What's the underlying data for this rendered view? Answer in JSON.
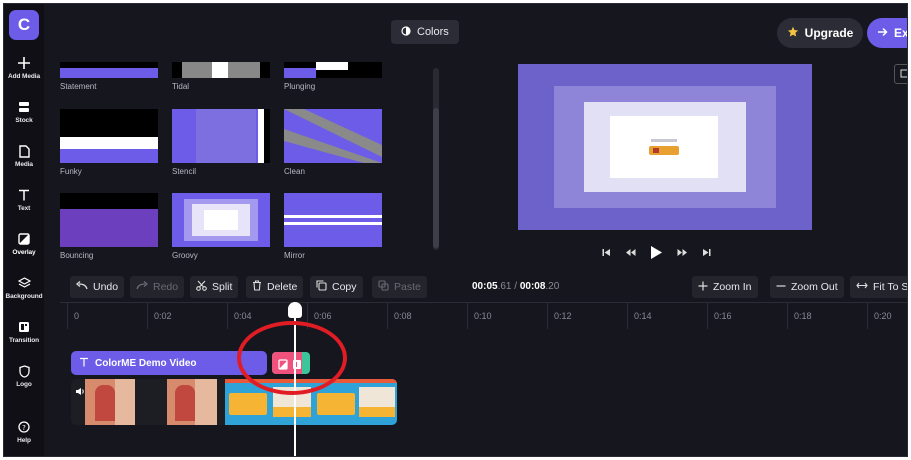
{
  "app": {
    "logo_letter": "C"
  },
  "sidebar": {
    "items": [
      {
        "label": "Add Media",
        "icon": "plus-icon"
      },
      {
        "label": "Stock",
        "icon": "stock-icon"
      },
      {
        "label": "Media",
        "icon": "file-icon"
      },
      {
        "label": "Text",
        "icon": "text-icon"
      },
      {
        "label": "Overlay",
        "icon": "overlay-icon",
        "active": true
      },
      {
        "label": "Background",
        "icon": "layers-icon"
      },
      {
        "label": "Transition",
        "icon": "transition-icon"
      },
      {
        "label": "Logo",
        "icon": "shield-icon"
      },
      {
        "label": "Help",
        "icon": "help-icon"
      }
    ]
  },
  "topbar": {
    "colors_label": "Colors",
    "upgrade_label": "Upgrade",
    "export_label": "Ex"
  },
  "overlays": {
    "tiles": [
      {
        "name": "Statement"
      },
      {
        "name": "Tidal"
      },
      {
        "name": "Plunging"
      },
      {
        "name": "Funky"
      },
      {
        "name": "Stencil"
      },
      {
        "name": "Clean"
      },
      {
        "name": "Bouncing"
      },
      {
        "name": "Groovy"
      },
      {
        "name": "Mirror"
      }
    ]
  },
  "toolbar": {
    "undo": "Undo",
    "redo": "Redo",
    "split": "Split",
    "delete": "Delete",
    "copy": "Copy",
    "paste": "Paste",
    "time_current_main": "00:05",
    "time_current_frac": ".61",
    "time_sep": " / ",
    "time_total_main": "00:08",
    "time_total_frac": ".20",
    "zoom_in": "Zoom In",
    "zoom_out": "Zoom Out",
    "fit": "Fit To Se"
  },
  "ruler": {
    "ticks": [
      "0",
      "0:02",
      "0:04",
      "0:06",
      "0:08",
      "0:10",
      "0:12",
      "0:14",
      "0:16",
      "0:18",
      "0:20"
    ]
  },
  "tracks": {
    "text_clip_label": "ColorME Demo Video"
  },
  "colors": {
    "accent": "#6c5ce7",
    "annotation": "#e01c24"
  }
}
